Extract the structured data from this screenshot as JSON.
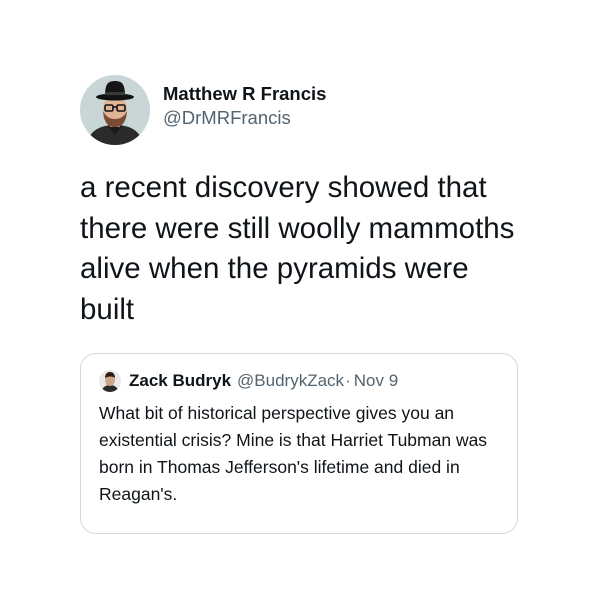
{
  "tweet": {
    "author": {
      "name": "Matthew R Francis",
      "handle": "@DrMRFrancis"
    },
    "text": "a recent discovery showed that there were still woolly mammoths alive when the pyramids were built"
  },
  "quote": {
    "author": {
      "name": "Zack Budryk",
      "handle": "@BudrykZack",
      "separator": "·",
      "date": "Nov 9"
    },
    "text": "What bit of historical perspective gives you an existential crisis? Mine is that Harriet Tubman was born in Thomas Jefferson's lifetime and died in Reagan's."
  },
  "colors": {
    "text_primary": "#0f1419",
    "text_secondary": "#536471",
    "border": "#cfd9de"
  }
}
